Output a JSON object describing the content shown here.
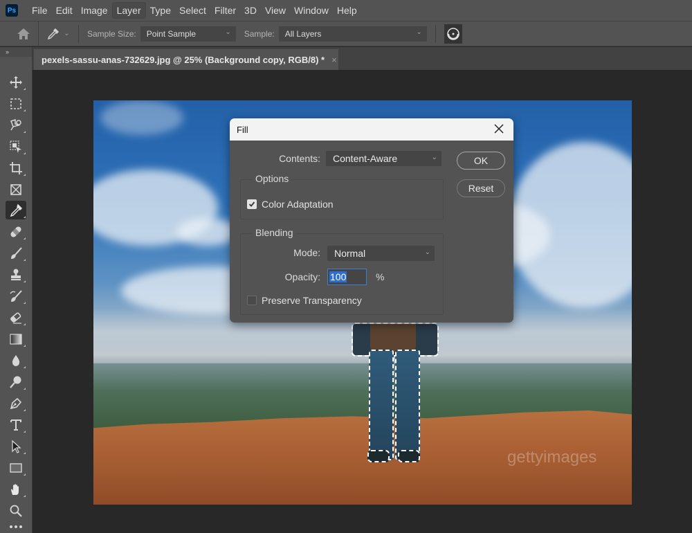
{
  "app": {
    "logo": "Ps",
    "menu": [
      "File",
      "Edit",
      "Image",
      "Layer",
      "Type",
      "Select",
      "Filter",
      "3D",
      "View",
      "Window",
      "Help"
    ],
    "active_menu": "Layer"
  },
  "options_bar": {
    "home_icon": "home-icon",
    "tool_icon": "eyedropper-icon",
    "sample_size_label": "Sample Size:",
    "sample_size_value": "Point Sample",
    "sample_label": "Sample:",
    "sample_value": "All Layers",
    "target_icon": "sampling-ring-icon"
  },
  "toolbar": {
    "collapse_label": "››",
    "tools": [
      {
        "name": "move-tool",
        "icon": "move-icon"
      },
      {
        "name": "rectangular-marquee-tool",
        "icon": "marquee-icon"
      },
      {
        "name": "lasso-tool",
        "icon": "lasso-icon"
      },
      {
        "name": "object-selection-tool",
        "icon": "object-selection-icon"
      },
      {
        "name": "crop-tool",
        "icon": "crop-icon"
      },
      {
        "name": "frame-tool",
        "icon": "frame-icon"
      },
      {
        "name": "eyedropper-tool",
        "icon": "eyedropper-icon",
        "active": true
      },
      {
        "name": "healing-brush-tool",
        "icon": "bandage-icon"
      },
      {
        "name": "brush-tool",
        "icon": "brush-icon"
      },
      {
        "name": "clone-stamp-tool",
        "icon": "stamp-icon"
      },
      {
        "name": "history-brush-tool",
        "icon": "history-brush-icon"
      },
      {
        "name": "eraser-tool",
        "icon": "eraser-icon"
      },
      {
        "name": "gradient-tool",
        "icon": "gradient-icon"
      },
      {
        "name": "blur-tool",
        "icon": "droplet-icon"
      },
      {
        "name": "dodge-tool",
        "icon": "dodge-icon"
      },
      {
        "name": "pen-tool",
        "icon": "pen-icon"
      },
      {
        "name": "type-tool",
        "icon": "type-icon"
      },
      {
        "name": "path-selection-tool",
        "icon": "arrow-icon"
      },
      {
        "name": "rectangle-tool",
        "icon": "rectangle-icon"
      },
      {
        "name": "hand-tool",
        "icon": "hand-icon"
      },
      {
        "name": "zoom-tool",
        "icon": "zoom-icon"
      },
      {
        "name": "edit-toolbar",
        "icon": "more-icon"
      }
    ]
  },
  "document": {
    "tab_title": "pexels-sassu-anas-732629.jpg @ 25% (Background copy, RGB/8) *",
    "close_glyph": "×",
    "watermark": "gettyimages"
  },
  "fill_dialog": {
    "title": "Fill",
    "contents_label": "Contents:",
    "contents_value": "Content-Aware",
    "ok_label": "OK",
    "reset_label": "Reset",
    "options_title": "Options",
    "color_adaptation_label": "Color Adaptation",
    "color_adaptation_checked": true,
    "blending_title": "Blending",
    "mode_label": "Mode:",
    "mode_value": "Normal",
    "opacity_label": "Opacity:",
    "opacity_value": "100",
    "opacity_unit": "%",
    "preserve_transparency_label": "Preserve Transparency",
    "preserve_transparency_checked": false
  }
}
